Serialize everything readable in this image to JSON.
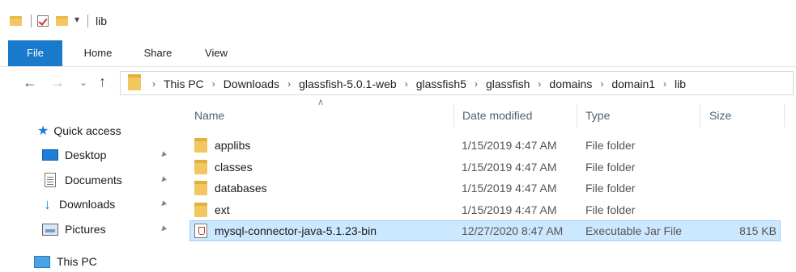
{
  "window": {
    "title": "lib"
  },
  "ribbon": {
    "tabs": [
      "File",
      "Home",
      "Share",
      "View"
    ]
  },
  "address": {
    "path": [
      "This PC",
      "Downloads",
      "glassfish-5.0.1-web",
      "glassfish5",
      "glassfish",
      "domains",
      "domain1",
      "lib"
    ]
  },
  "nav": {
    "quick_access": "Quick access",
    "pinned": [
      {
        "label": "Desktop",
        "icon": "desktop-icon"
      },
      {
        "label": "Documents",
        "icon": "documents-icon"
      },
      {
        "label": "Downloads",
        "icon": "downloads-icon"
      },
      {
        "label": "Pictures",
        "icon": "pictures-icon"
      }
    ],
    "this_pc": "This PC"
  },
  "list": {
    "columns": {
      "name": "Name",
      "date": "Date modified",
      "type": "Type",
      "size": "Size"
    },
    "rows": [
      {
        "name": "applibs",
        "date": "1/15/2019 4:47 AM",
        "type": "File folder",
        "size": "",
        "icon": "folder-icon"
      },
      {
        "name": "classes",
        "date": "1/15/2019 4:47 AM",
        "type": "File folder",
        "size": "",
        "icon": "folder-icon"
      },
      {
        "name": "databases",
        "date": "1/15/2019 4:47 AM",
        "type": "File folder",
        "size": "",
        "icon": "folder-icon"
      },
      {
        "name": "ext",
        "date": "1/15/2019 4:47 AM",
        "type": "File folder",
        "size": "",
        "icon": "folder-icon"
      },
      {
        "name": "mysql-connector-java-5.1.23-bin",
        "date": "12/27/2020 8:47 AM",
        "type": "Executable Jar File",
        "size": "815 KB",
        "icon": "jar-file-icon",
        "selected": true
      }
    ]
  },
  "colors": {
    "accent": "#1979ca",
    "selection": "#cce8ff",
    "folder": "#f3c75f"
  }
}
